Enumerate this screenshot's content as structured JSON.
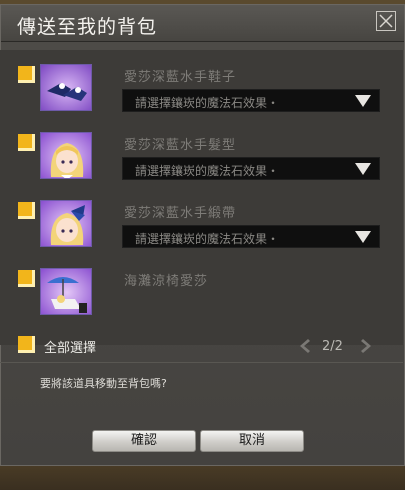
{
  "dialog": {
    "title": "傳送至我的背包",
    "close_icon": "close-icon"
  },
  "items": [
    {
      "name": "愛莎深藍水手鞋子",
      "dropdown": "請選擇鑲崁的魔法石效果・",
      "has_dropdown": true,
      "icon": "shoes-icon"
    },
    {
      "name": "愛莎深藍水手髮型",
      "dropdown": "請選擇鑲崁的魔法石效果・",
      "has_dropdown": true,
      "icon": "hair-icon"
    },
    {
      "name": "愛莎深藍水手緞帶",
      "dropdown": "請選擇鑲崁的魔法石效果・",
      "has_dropdown": true,
      "icon": "ribbon-icon"
    },
    {
      "name": "海灘涼椅愛莎",
      "has_dropdown": false,
      "icon": "beach-chair-icon"
    }
  ],
  "select_all": {
    "label": "全部選擇"
  },
  "pager": {
    "text": "2/2"
  },
  "prompt": "要將該道具移動至背包嗎?",
  "buttons": {
    "confirm": "確認",
    "cancel": "取消"
  },
  "colors": {
    "checkbox": "#f2b51b",
    "thumb_bg": "#9b6ad0"
  }
}
